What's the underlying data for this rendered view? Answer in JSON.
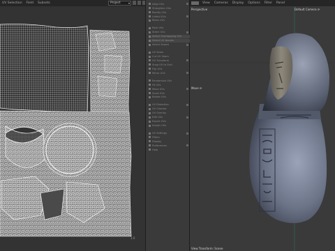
{
  "uv_editor": {
    "menu": [
      "UV Selection",
      "Field",
      "Subsets"
    ],
    "project_selector": "Project",
    "bottom_coord": "1.0"
  },
  "tool_panel": {
    "items": [
      {
        "label": "Align UVs"
      },
      {
        "label": "Straighten UVs"
      },
      {
        "label": "Rectify UVs"
      },
      {
        "label": "Unfold UVs"
      },
      {
        "label": "Relax UVs"
      },
      {
        "label": "Pack UVs"
      },
      {
        "label": "Stitch UVs"
      },
      {
        "label": "Select Overlapping UVs"
      },
      {
        "label": "Select UV Islands"
      },
      {
        "label": "Select Seams"
      },
      {
        "label": "UV Seam"
      },
      {
        "label": "Cut UV Seam"
      },
      {
        "label": "UV Transform"
      },
      {
        "label": "Snap UV to Grid"
      },
      {
        "label": "Flip UVs"
      },
      {
        "label": "Mirror UVs"
      },
      {
        "label": "Randomize UVs"
      },
      {
        "label": "Fit UVs"
      },
      {
        "label": "Move UVs"
      },
      {
        "label": "Scale UVs"
      },
      {
        "label": "Rotate UVs"
      },
      {
        "label": "UV Distortion"
      },
      {
        "label": "UV Checker"
      },
      {
        "label": "UV Overlay"
      },
      {
        "label": "Edit UVs"
      },
      {
        "label": "Export UVs"
      },
      {
        "label": "Import UVs"
      },
      {
        "label": "UV Settings"
      },
      {
        "label": "Filters"
      },
      {
        "label": "Display"
      },
      {
        "label": "Preferences"
      },
      {
        "label": "Help"
      }
    ]
  },
  "viewport": {
    "menu": [
      "View",
      "Cameras",
      "Display",
      "Options",
      "Filter",
      "Panel"
    ],
    "view_name": "Perspective",
    "camera_name": "Default Camera ⟳",
    "move_label": "Move ⟳",
    "bottom_status": "View Transform: Scene"
  }
}
